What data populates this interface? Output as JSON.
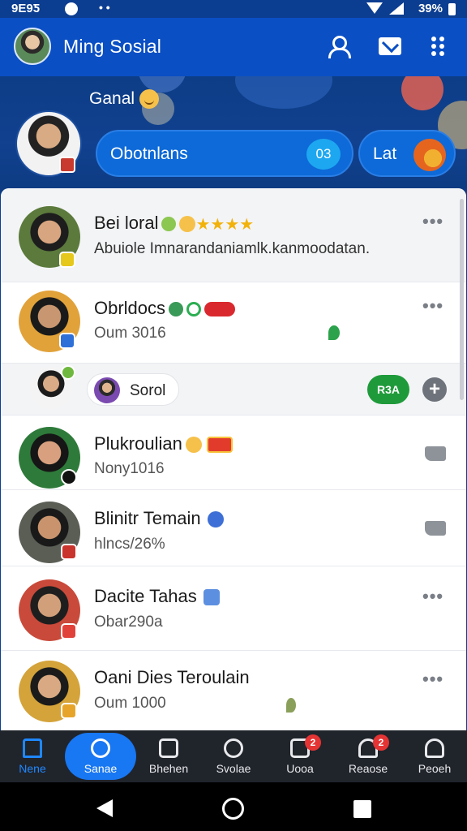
{
  "status_bar": {
    "time": "9E9Ƽ",
    "battery": "39%"
  },
  "app_bar": {
    "title": "Ming Sosial"
  },
  "hero": {
    "greeting": "Ganal",
    "pill_label": "Obotnlans",
    "pill_count": "03",
    "pill2_label": "Lat"
  },
  "feed": [
    {
      "name": "Bei loral",
      "sub": "Abuiole Imnarandaniamlk.kanmoodatan."
    },
    {
      "name": "Obrldocs",
      "sub": "Oum 3016"
    },
    {
      "chip_label": "Sorol",
      "green_label": "R3A"
    },
    {
      "name": "Plukroulian",
      "sub": "Nony1016"
    },
    {
      "name": "Blinitr Temain",
      "sub": "hlncs/26%"
    },
    {
      "name": "Dacite Tahas",
      "sub": "Obar290a"
    },
    {
      "name": "Oani Dies Teroulain",
      "sub": "Oum 1000"
    }
  ],
  "nav": [
    {
      "label": "Nene"
    },
    {
      "label": "Sanae"
    },
    {
      "label": "Bhehen"
    },
    {
      "label": "Svolae"
    },
    {
      "label": "Uooa",
      "badge": "2"
    },
    {
      "label": "Reaose",
      "badge": "2"
    },
    {
      "label": "Peoeh"
    }
  ],
  "colors": {
    "brand": "#0a4fc4",
    "accent": "#1877f2",
    "nav_bg": "#20242b",
    "success": "#1f9a3b",
    "danger": "#e43434"
  }
}
